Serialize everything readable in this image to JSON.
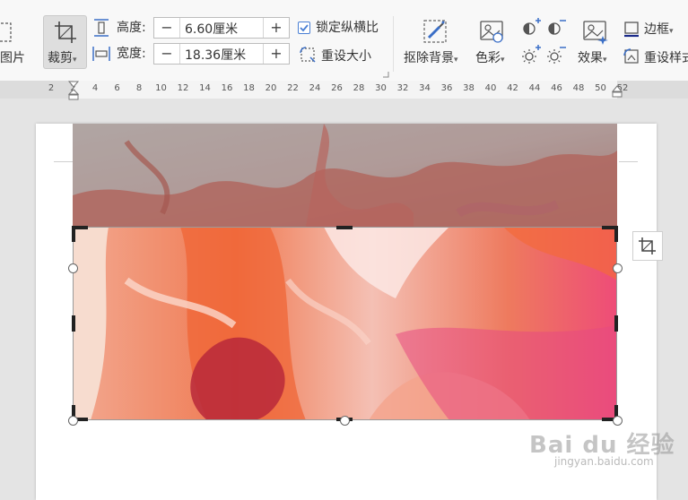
{
  "ribbon": {
    "picture_label": "图片",
    "crop_label": "裁剪",
    "height_label": "高度:",
    "height_value": "6.60厘米",
    "width_label": "宽度:",
    "width_value": "18.36厘米",
    "lock_ratio_label": "锁定纵横比",
    "lock_ratio_checked": true,
    "reset_size_label": "重设大小",
    "remove_bg_label": "抠除背景",
    "color_label": "色彩",
    "effects_label": "效果",
    "border_label": "边框",
    "reset_style_label": "重设样式",
    "minus_symbol": "−",
    "plus_symbol": "+",
    "dropdown_symbol": "▾"
  },
  "ruler": {
    "ticks": [
      "2",
      "2",
      "4",
      "6",
      "8",
      "10",
      "12",
      "14",
      "16",
      "18",
      "20",
      "22",
      "24",
      "26",
      "28",
      "30",
      "32",
      "34",
      "36",
      "38",
      "40",
      "42",
      "44",
      "46",
      "48",
      "50",
      "52"
    ]
  },
  "watermark": {
    "brand": "Bai du 经验",
    "url": "jingyan.baidu.com"
  },
  "colors": {
    "accent": "#4a7fd4",
    "ribbon_bg": "#f8f8f8",
    "workspace_bg": "#e4e4e4"
  }
}
